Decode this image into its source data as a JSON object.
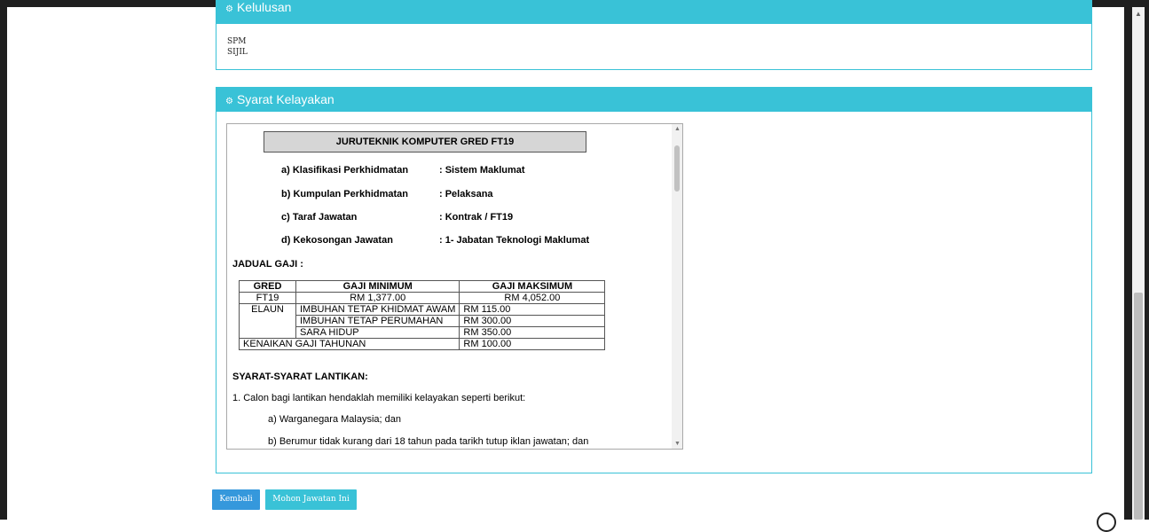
{
  "kelulusan": {
    "header_label": "Kelulusan",
    "items": [
      "SPM",
      "SIJIL"
    ]
  },
  "syarat": {
    "header_label": "Syarat Kelayakan",
    "doc": {
      "title": "JURUTEKNIK KOMPUTER GRED FT19",
      "info": [
        {
          "label": "a) Klasifikasi Perkhidmatan",
          "value": ": Sistem Maklumat"
        },
        {
          "label": "b) Kumpulan Perkhidmatan",
          "value": ": Pelaksana"
        },
        {
          "label": "c) Taraf Jawatan",
          "value": ": Kontrak / FT19"
        },
        {
          "label": "d) Kekosongan Jawatan",
          "value": ": 1- Jabatan Teknologi Maklumat"
        }
      ],
      "jadual_title": "JADUAL GAJI :",
      "table": {
        "headers": [
          "GRED",
          "GAJI MINIMUM",
          "GAJI MAKSIMUM"
        ],
        "gred": "FT19",
        "min": "RM 1,377.00",
        "max": "RM 4,052.00",
        "elaun_label": "ELAUN",
        "elaun": [
          {
            "name": "IMBUHAN TETAP KHIDMAT AWAM",
            "amount": "RM 115.00"
          },
          {
            "name": "IMBUHAN TETAP PERUMAHAN",
            "amount": "RM 300.00"
          },
          {
            "name": "SARA HIDUP",
            "amount": "RM 350.00"
          }
        ],
        "kenaikan_label": "KENAIKAN GAJI TAHUNAN",
        "kenaikan_amount": "RM 100.00"
      },
      "syarat_title": "SYARAT-SYARAT LANTIKAN:",
      "paragraphs": [
        "1. Calon bagi lantikan hendaklah memiliki kelayakan seperti berikut:",
        "a) Warganegara Malaysia; dan",
        "b) Berumur tidak kurang dari 18 tahun pada tarikh tutup iklan jawatan; dan"
      ]
    }
  },
  "buttons": {
    "back": "Kembali",
    "apply": "Mohon Jawatan Ini"
  },
  "colors": {
    "panel_header": "#39c2d7",
    "button_primary": "#3598dc"
  },
  "icons": [
    "cogs-icon",
    "circle-icon"
  ]
}
